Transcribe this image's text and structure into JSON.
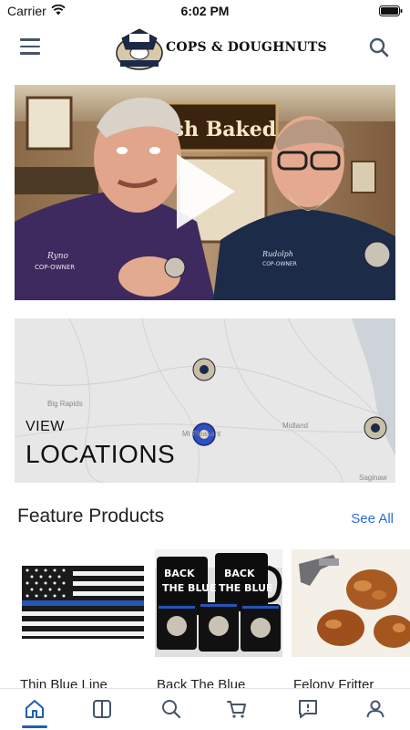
{
  "status_bar": {
    "carrier": "Carrier",
    "time": "6:02 PM"
  },
  "header": {
    "logo_text": "COPS & DOUGHNUTS",
    "menu_icon": "hamburger-menu-icon",
    "search_icon": "search-icon"
  },
  "video": {
    "sign_text": "Fresh Baked",
    "person_left_name": "Ryno",
    "person_left_title": "COP-OWNER",
    "person_right_name": "Rudolph",
    "person_right_title": "COP-OWNER",
    "play_icon": "play-icon"
  },
  "locations": {
    "label_small": "VIEW",
    "label_big": "LOCATIONS",
    "cities": [
      "Big Rapids",
      "Mt Pleasant",
      "Midland",
      "Saginaw"
    ]
  },
  "feature_products": {
    "title": "Feature Products",
    "see_all": "See All",
    "items": [
      {
        "name": "Thin Blue Line"
      },
      {
        "name": "Back The Blue"
      },
      {
        "name": "Felony Fritter"
      }
    ],
    "mug_text": [
      "BACK",
      "THE BLUE"
    ]
  },
  "tab_bar": {
    "tabs": [
      "home-icon",
      "book-icon",
      "search-icon",
      "cart-icon",
      "feedback-icon",
      "profile-icon"
    ],
    "active_index": 0
  },
  "colors": {
    "accent": "#2a6ed8",
    "icon": "#44546a",
    "tab_active": "#1f5fae"
  }
}
